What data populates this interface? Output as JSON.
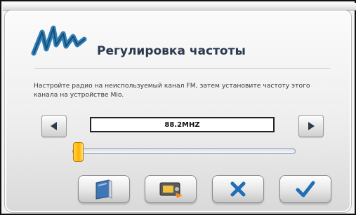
{
  "dialog": {
    "title": "Регулировка частоты",
    "description": "Настройте радио на неиспользуемый канал FM, затем установите частоту этого канала на устройстве Mio."
  },
  "frequency": {
    "value": "88.2MHZ",
    "slider_position": 0.03
  },
  "icons": {
    "logo": "mio-logo",
    "decrease": "left-arrow-icon",
    "increase": "right-arrow-icon",
    "button1": "book-icon",
    "button2": "radio-icon",
    "cancel": "close-icon",
    "confirm": "checkmark-icon"
  },
  "colors": {
    "logo": "#2f7fb8",
    "title": "#2b3a4f",
    "slider_thumb": "#ffb000",
    "cancel": "#1f6fb7",
    "confirm": "#1f6fb7"
  }
}
